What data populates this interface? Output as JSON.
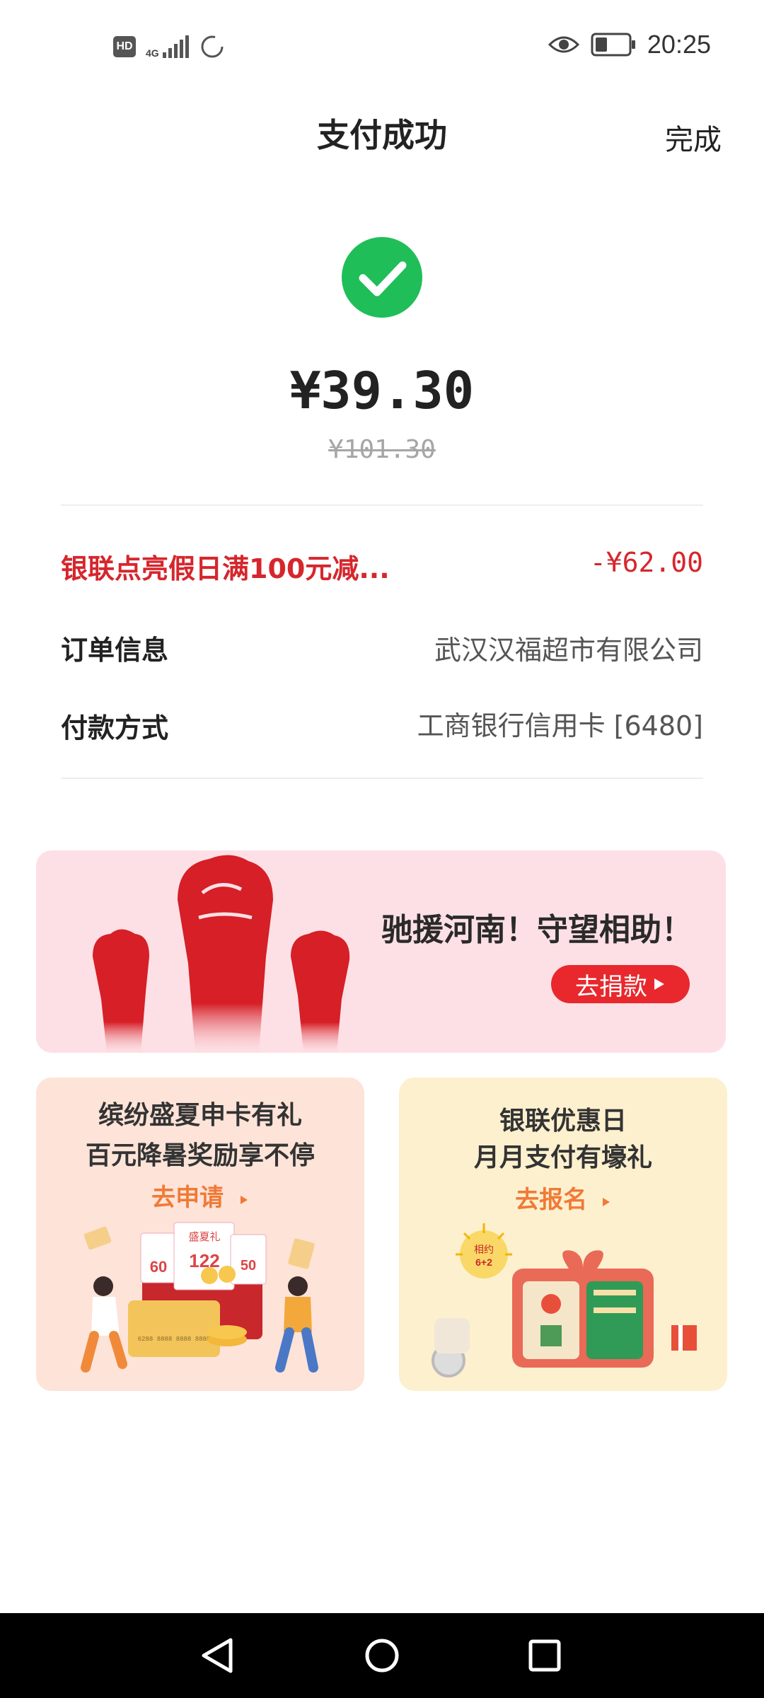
{
  "status_bar": {
    "hd_label": "HD",
    "network_label": "4G",
    "time": "20:25",
    "icons": [
      "hd-icon",
      "signal-icon",
      "loading-icon",
      "eye-icon",
      "battery-icon"
    ]
  },
  "header": {
    "title": "支付成功",
    "done_label": "完成"
  },
  "payment": {
    "status_icon": "check-icon",
    "amount": "¥39.30",
    "original_amount": "¥101.30"
  },
  "details": [
    {
      "label": "银联点亮假日满100元减...",
      "value": "-¥62.00"
    },
    {
      "label": "订单信息",
      "value": "武汉汉福超市有限公司"
    },
    {
      "label": "付款方式",
      "value": "工商银行信用卡 [6480]"
    }
  ],
  "banner": {
    "text": "驰援河南！守望相助！",
    "button_label": "去捐款"
  },
  "cards": [
    {
      "line1": "缤纷盛夏申卡有礼",
      "line2": "百元降暑奖励享不停",
      "cta": "去申请",
      "art_texts": [
        "盛夏礼",
        "122",
        "60",
        "50",
        "6288 8888 8888 8888"
      ]
    },
    {
      "line1": "银联优惠日",
      "line2": "月月支付有壕礼",
      "cta": "去报名",
      "art_texts": [
        "相约",
        "6+2"
      ]
    }
  ],
  "colors": {
    "success": "#1fbe58",
    "accent_red": "#d6262d",
    "cta_orange": "#f07a37",
    "banner_bg": "#fde0e5"
  },
  "nav_bar": {
    "icons": [
      "back-icon",
      "home-icon",
      "recents-icon"
    ]
  }
}
